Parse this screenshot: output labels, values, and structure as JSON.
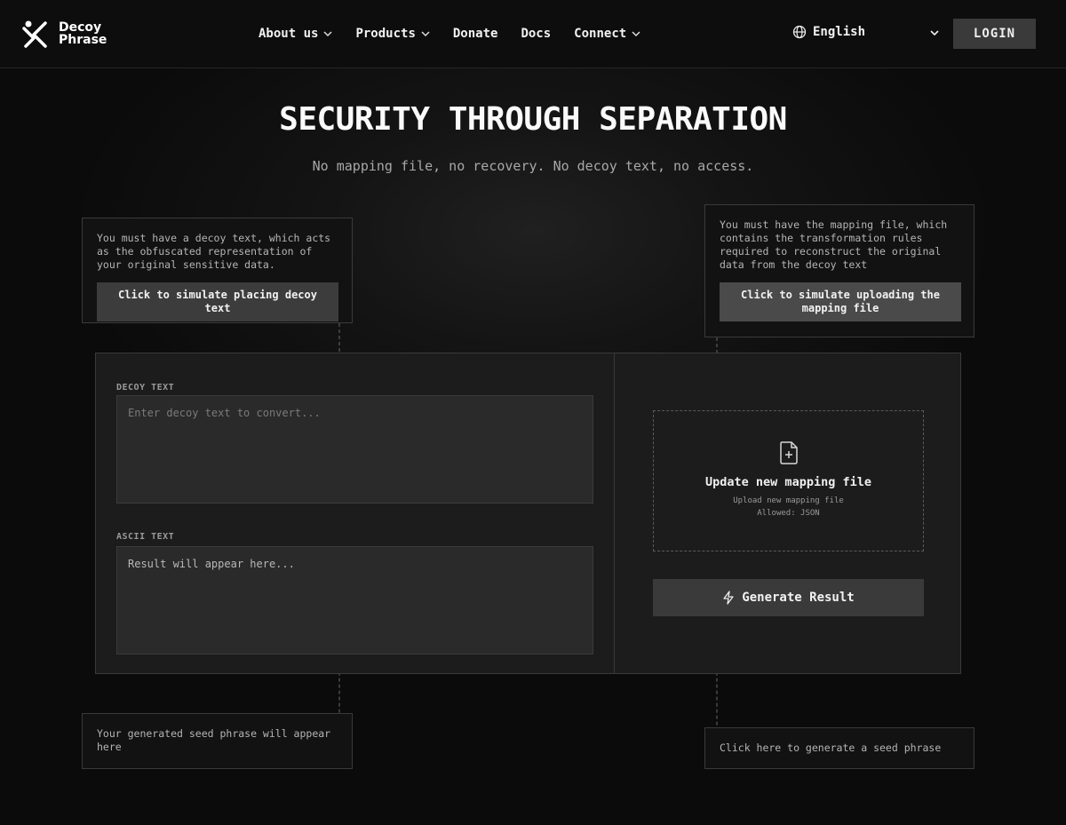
{
  "brand": {
    "line1": "Decoy",
    "line2": "Phrase"
  },
  "nav": {
    "items": [
      {
        "label": "About us",
        "dropdown": true
      },
      {
        "label": "Products",
        "dropdown": true
      },
      {
        "label": "Donate",
        "dropdown": false
      },
      {
        "label": "Docs",
        "dropdown": false
      },
      {
        "label": "Connect",
        "dropdown": true
      }
    ],
    "language": "English",
    "login": "LOGIN"
  },
  "hero": {
    "title": "SECURITY THROUGH SEPARATION",
    "subtitle": "No mapping file, no recovery. No decoy text, no access."
  },
  "callouts": {
    "decoy": {
      "text": "You must have a decoy text, which acts as the obfuscated representation of your original sensitive data.",
      "button": "Click to simulate placing decoy text"
    },
    "mapping": {
      "text": "You must have the mapping file, which contains the transformation rules required to reconstruct the original data from the decoy text",
      "button": "Click to simulate uploading the mapping file"
    },
    "seed_result": {
      "text": "Your generated seed phrase will appear here"
    },
    "generate_hint": {
      "text": "Click here to generate a seed phrase"
    }
  },
  "converter": {
    "decoy_label": "DECOY TEXT",
    "decoy_placeholder": "Enter decoy text to convert...",
    "ascii_label": "ASCII TEXT",
    "ascii_placeholder": "Result will appear here...",
    "upload_title": "Update new mapping file",
    "upload_sub": "Upload new mapping file",
    "upload_allowed": "Allowed: JSON",
    "generate_label": "Generate Result"
  },
  "icons": {
    "logo": "decoy-phrase-logo",
    "language": "globe-icon",
    "upload": "file-plus-icon",
    "generate": "lightning-icon"
  },
  "colors": {
    "background": "#0b0b0b",
    "panel": "#1c1c1c",
    "button": "#3a3a3a",
    "text": "#e6e6e6"
  }
}
